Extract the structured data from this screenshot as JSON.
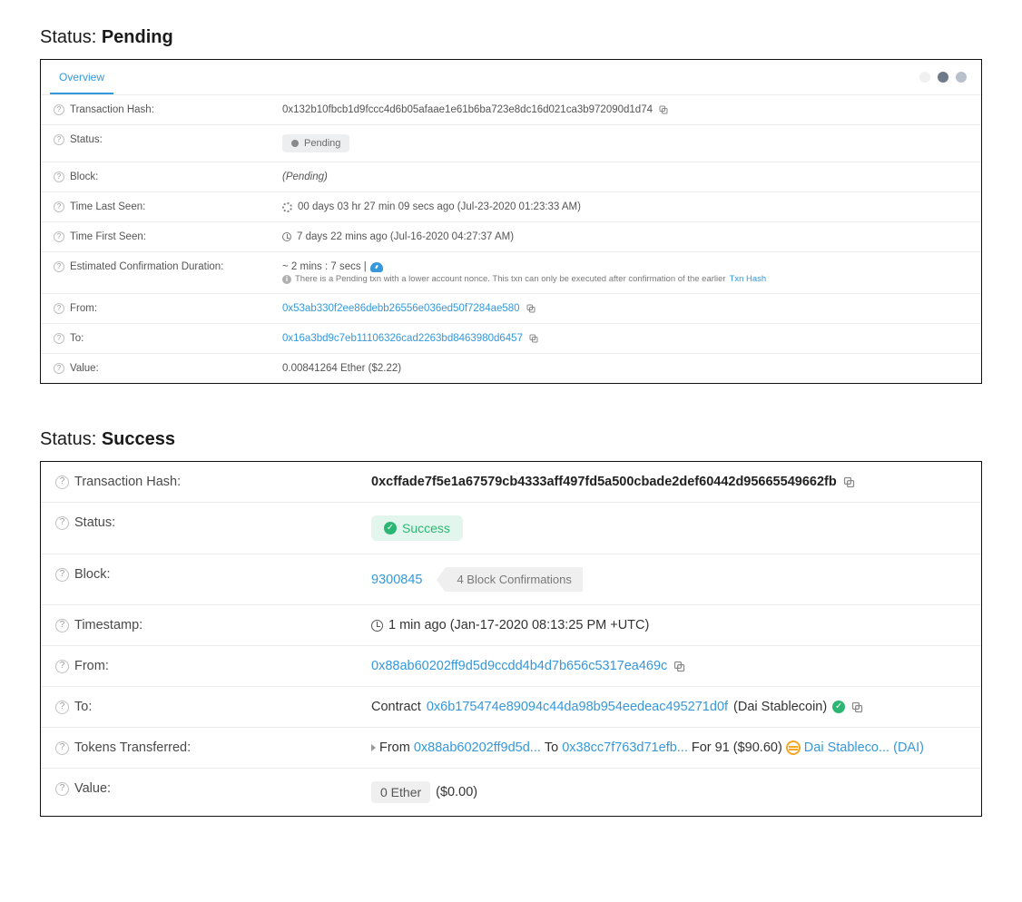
{
  "headings": {
    "pending_label": "Status: ",
    "pending_value": "Pending",
    "success_label": "Status: ",
    "success_value": "Success"
  },
  "pending": {
    "tab": "Overview",
    "labels": {
      "txhash": "Transaction Hash:",
      "status": "Status:",
      "block": "Block:",
      "last_seen": "Time Last Seen:",
      "first_seen": "Time First Seen:",
      "eta": "Estimated Confirmation Duration:",
      "from": "From:",
      "to": "To:",
      "value": "Value:"
    },
    "txhash": "0x132b10fbcb1d9fccc4d6b05afaae1e61b6ba723e8dc16d021ca3b972090d1d74",
    "status_pill": "Pending",
    "block": "(Pending)",
    "last_seen": "00 days 03 hr 27 min 09 secs ago (Jul-23-2020 01:23:33 AM)",
    "first_seen": "7 days 22 mins ago (Jul-16-2020 04:27:37 AM)",
    "eta": "~ 2 mins : 7 secs | ",
    "eta_note": "There is a Pending txn with a lower account nonce. This txn can only be executed after confirmation of the earlier ",
    "eta_link": "Txn Hash",
    "from": "0x53ab330f2ee86debb26556e036ed50f7284ae580",
    "to": "0x16a3bd9c7eb11106326cad2263bd8463980d6457",
    "value": "0.00841264 Ether ($2.22)"
  },
  "success": {
    "labels": {
      "txhash": "Transaction Hash:",
      "status": "Status:",
      "block": "Block:",
      "timestamp": "Timestamp:",
      "from": "From:",
      "to": "To:",
      "tokens": "Tokens Transferred:",
      "value": "Value:"
    },
    "txhash": "0xcffade7f5e1a67579cb4333aff497fd5a500cbade2def60442d95665549662fb",
    "status_pill": "Success",
    "block": "9300845",
    "confirmations": "4 Block Confirmations",
    "timestamp": "1 min ago (Jan-17-2020 08:13:25 PM +UTC)",
    "from": "0x88ab60202ff9d5d9ccdd4b4d7b656c5317ea469c",
    "to_prefix": "Contract",
    "to": "0x6b175474e89094c44da98b954eedeac495271d0f",
    "to_suffix": "(Dai Stablecoin)",
    "transfer": {
      "from_label": "From",
      "from": "0x88ab60202ff9d5d...",
      "to_label": "To",
      "to": "0x38cc7f763d71efb...",
      "for_label": "For",
      "amount": "91",
      "usd": "($90.60)",
      "token": "Dai Stableco... (DAI)"
    },
    "value_chip": "0 Ether",
    "value_usd": "($0.00)"
  }
}
